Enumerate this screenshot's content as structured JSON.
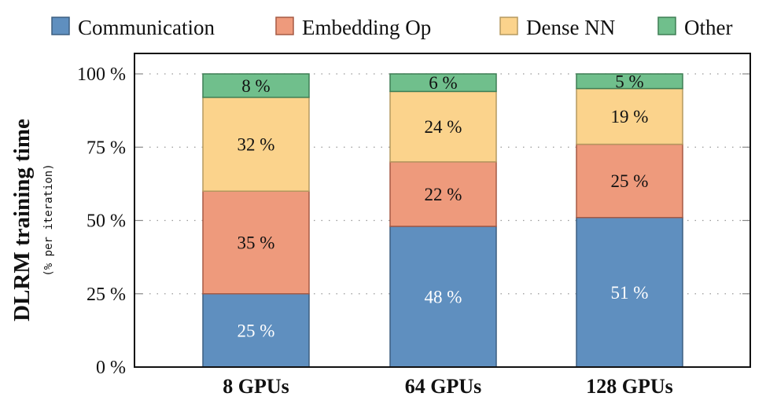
{
  "chart_data": {
    "type": "bar",
    "stacked": true,
    "title": "",
    "xlabel": "",
    "ylabel": "DLRM training time",
    "ylabel_sub": "(% per iteration)",
    "categories": [
      "8 GPUs",
      "64 GPUs",
      "128 GPUs"
    ],
    "series": [
      {
        "name": "Communication",
        "values": [
          25,
          48,
          51
        ],
        "color": "#5f8fbf",
        "edge": "#3d5f80",
        "label_color": "#ffffff"
      },
      {
        "name": "Embedding Op",
        "values": [
          35,
          22,
          25
        ],
        "color": "#ee9a7c",
        "edge": "#a55a45",
        "label_color": "#111111"
      },
      {
        "name": "Dense NN",
        "values": [
          32,
          24,
          19
        ],
        "color": "#fbd38c",
        "edge": "#b59a60",
        "label_color": "#111111"
      },
      {
        "name": "Other",
        "values": [
          8,
          6,
          5
        ],
        "color": "#70bf8c",
        "edge": "#3f7f55",
        "label_color": "#111111"
      }
    ],
    "ylim": [
      0,
      100
    ],
    "yticks": [
      0,
      25,
      50,
      75,
      100
    ],
    "ytick_labels": [
      "0 %",
      "25 %",
      "50 %",
      "75 %",
      "100 %"
    ],
    "value_suffix": " %",
    "grid": true,
    "grid_style": "dotted-horizontal",
    "legend_position": "top-center"
  }
}
